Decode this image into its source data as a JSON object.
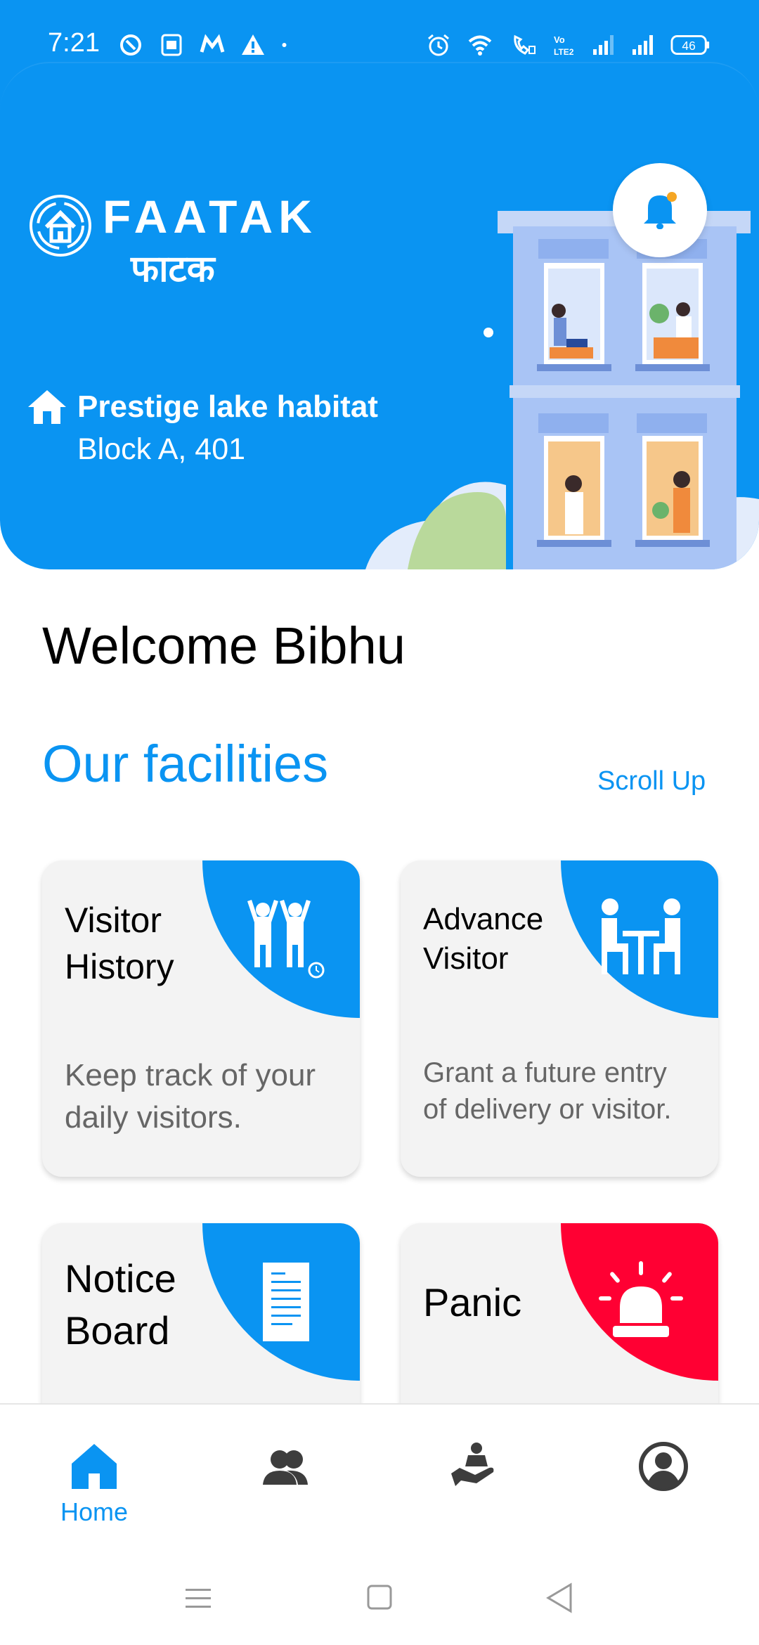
{
  "status_bar": {
    "time": "7:21",
    "battery": "46",
    "icons_left": [
      "nfc-icon",
      "sim-icon",
      "gmail-icon",
      "warning-icon",
      "dot-icon"
    ],
    "icons_right": [
      "alarm-icon",
      "wifi-icon",
      "wifi-calling-icon",
      "volte-icon",
      "signal-icon",
      "signal-icon",
      "battery-icon"
    ]
  },
  "header": {
    "logo_en": "FAATAK",
    "logo_hi": "फाटक",
    "society_name": "Prestige lake habitat",
    "flat": "Block A, 401",
    "bell_icon": "bell-icon",
    "colors": {
      "primary": "#0a94f2",
      "panic": "#ff0033",
      "card_bg": "#f3f3f3"
    }
  },
  "main": {
    "welcome": "Welcome Bibhu",
    "facilities_title": "Our facilities",
    "scroll_up": "Scroll Up",
    "cards": [
      {
        "title_line1": "Visitor",
        "title_line2": "History",
        "desc_line1": "Keep track of your",
        "desc_line2": "daily visitors.",
        "icon": "visitors-icon"
      },
      {
        "title_line1": "Advance",
        "title_line2": "Visitor",
        "desc_line1": "Grant a future entry",
        "desc_line2": "of delivery or visitor.",
        "icon": "meeting-icon"
      },
      {
        "title_line1": "Notice",
        "title_line2": "Board",
        "icon": "notice-icon"
      },
      {
        "title_line1": "Panic",
        "icon": "siren-icon"
      }
    ]
  },
  "bottom_nav": {
    "items": [
      {
        "label": "Home",
        "icon": "home-icon",
        "active": true
      },
      {
        "label": "",
        "icon": "people-icon"
      },
      {
        "label": "",
        "icon": "helping-hand-icon"
      },
      {
        "label": "",
        "icon": "profile-icon"
      }
    ]
  },
  "system_nav": [
    "menu-icon",
    "home-square-icon",
    "back-triangle-icon"
  ]
}
